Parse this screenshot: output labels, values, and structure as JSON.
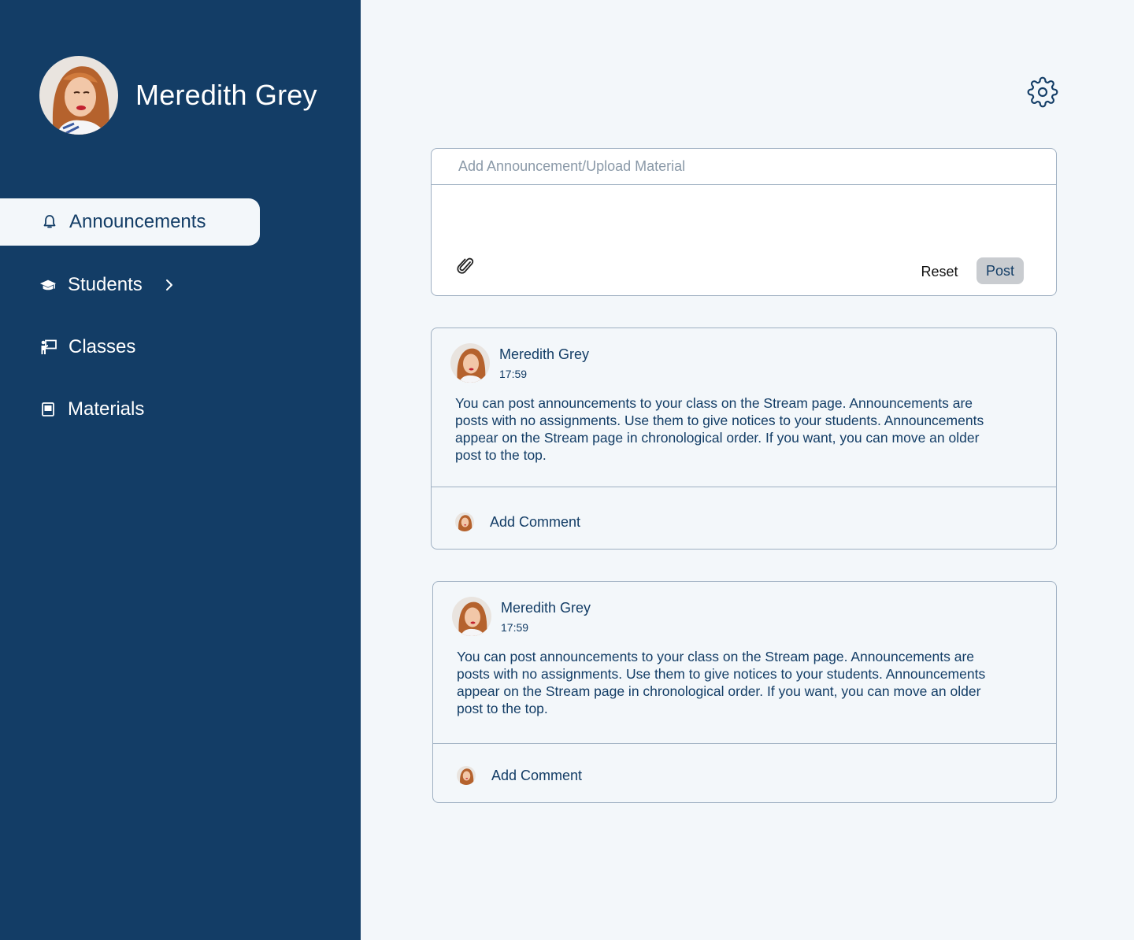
{
  "user": {
    "name": "Meredith Grey"
  },
  "sidebar": {
    "items": [
      {
        "label": "Announcements",
        "icon": "bell-icon",
        "active": true
      },
      {
        "label": "Students",
        "icon": "graduation-cap-icon",
        "has_submenu": true
      },
      {
        "label": "Classes",
        "icon": "teacher-board-icon"
      },
      {
        "label": "Materials",
        "icon": "book-icon"
      }
    ]
  },
  "header": {
    "settings_icon": "gear-icon"
  },
  "composer": {
    "placeholder": "Add Announcement/Upload Material",
    "attach_icon": "paperclip-icon",
    "reset_label": "Reset",
    "post_label": "Post"
  },
  "posts": [
    {
      "author": "Meredith Grey",
      "time": "17:59",
      "body": "You can post announcements to your class on the Stream page. Announcements are posts with no assignments. Use them to give notices to your students. Announcements appear on the Stream page in chronological order. If you want, you can move an older post to the top.",
      "comment_label": "Add Comment"
    },
    {
      "author": "Meredith Grey",
      "time": "17:59",
      "body": "You can post announcements to your class on the Stream page. Announcements are posts with no assignments. Use them to give notices to your students. Announcements appear on the Stream page in chronological order. If you want, you can move an older post to the top.",
      "comment_label": "Add Comment"
    }
  ],
  "colors": {
    "sidebar_bg": "#133d66",
    "page_bg": "#f3f7fa",
    "text_primary": "#133d66",
    "border": "#9fb0c2",
    "post_button_bg": "#c9ccd0"
  }
}
